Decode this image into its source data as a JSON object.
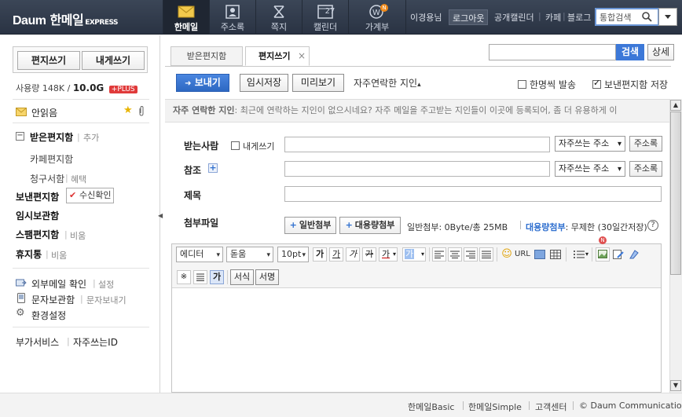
{
  "app": {
    "brand_daum": "Daum",
    "brand_name": "한메일",
    "brand_tag": "EXPRESS"
  },
  "topnav": {
    "items": [
      {
        "label": "한메일",
        "icon": "mail-icon"
      },
      {
        "label": "주소록",
        "icon": "contacts-icon"
      },
      {
        "label": "쪽지",
        "icon": "note-icon"
      },
      {
        "label": "캘린더",
        "icon": "calendar-icon",
        "day": "27"
      },
      {
        "label": "가계부",
        "icon": "wallet-icon",
        "badge": "N"
      }
    ],
    "user": "이경용님",
    "logout": "로그아웃",
    "links": [
      "공개캘린더",
      "카페",
      "블로그"
    ],
    "search_placeholder": "통합검색"
  },
  "sidebar": {
    "compose": "편지쓰기",
    "compose_self": "내게쓰기",
    "usage_label": "사용량",
    "usage_used": "148K",
    "usage_sep": "/",
    "usage_total": "10.0G",
    "plus": "+PLUS",
    "unread": "안읽음",
    "inbox": "받은편지함",
    "inbox_add": "추가",
    "cafe": "카페편지함",
    "bill": "청구서함",
    "bill_sub": "혜택",
    "sent": "보낸편지함",
    "receipt": "수신확인",
    "drafts": "임시보관함",
    "spam": "스팸편지함",
    "spam_sub": "비움",
    "trash": "휴지통",
    "trash_sub": "비움",
    "external": "외부메일 확인",
    "external_sub": "설정",
    "sms": "문자보관함",
    "sms_sub": "문자보내기",
    "settings": "환경설정",
    "extra": "부가서비스",
    "frequent_id": "자주쓰는ID"
  },
  "tabs": {
    "inbox": "받은편지함",
    "compose": "편지쓰기",
    "close": "×"
  },
  "search": {
    "button": "검색",
    "detail": "상세"
  },
  "actions": {
    "send": "보내기",
    "save_draft": "임시저장",
    "preview": "미리보기",
    "frequent_contacts": "자주연락한 지인",
    "individual_send": "한명씩 발송",
    "individual_checked": false,
    "save_sent": "보낸편지함 저장",
    "save_sent_checked": true
  },
  "freq_notice": {
    "title": "자주 연락한 지인",
    "text": ": 최근에 연락하는 지인이 없으시네요? 자주 메일을 주고받는 지인들이 이곳에 등록되어, 좀 더 유용하게 이"
  },
  "form": {
    "to_label": "받는사람",
    "to_self": "내게쓰기",
    "to_value": "",
    "cc_label": "참조",
    "cc_value": "",
    "subject_label": "제목",
    "subject_value": "",
    "freq_addr": "자주쓰는 주소",
    "addressbook": "주소록",
    "attach_label": "첨부파일",
    "attach_normal": "일반첨부",
    "attach_large": "대용량첨부",
    "attach_normal_info": "일반첨부: 0Byte/총 25MB",
    "attach_large_label": "대용량첨부",
    "attach_large_info": ": 무제한 (30일간저장)",
    "help": "?"
  },
  "editor": {
    "mode": "에디터",
    "font": "돋움",
    "size": "10pt",
    "bold": "가",
    "underline": "가",
    "italic": "가",
    "strike": "가",
    "fontcolor": "가",
    "bgcolor": "가",
    "url": "URL",
    "format": "서식",
    "signature": "서명",
    "special_char": "※",
    "badge": "N"
  },
  "footer": {
    "basic": "한메일Basic",
    "simple": "한메일Simple",
    "support": "고객센터",
    "copyright": "© Daum Communications."
  }
}
